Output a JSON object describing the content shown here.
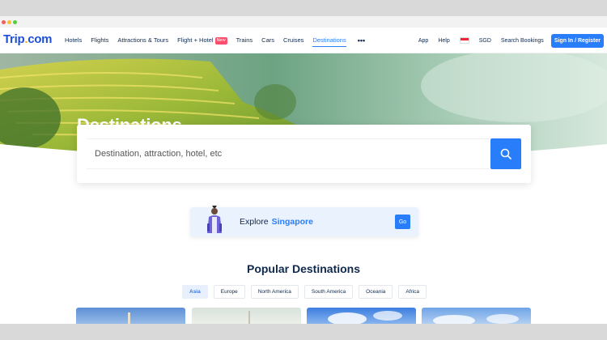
{
  "window": {
    "controls": [
      "close",
      "minimize",
      "maximize"
    ]
  },
  "header": {
    "logo_main": "Trip",
    "logo_dot": ".",
    "logo_suffix": "com",
    "nav": [
      {
        "label": "Hotels"
      },
      {
        "label": "Flights"
      },
      {
        "label": "Attractions & Tours"
      },
      {
        "label": "Flight + Hotel",
        "badge": "New"
      },
      {
        "label": "Trains"
      },
      {
        "label": "Cars"
      },
      {
        "label": "Cruises"
      },
      {
        "label": "Destinations",
        "active": true
      }
    ],
    "more_icon": "more-icon",
    "app": "App",
    "help": "Help",
    "flag_icon": "singapore-flag-icon",
    "currency": "SGD",
    "search_bookings": "Search Bookings",
    "signin": "Sign In / Register"
  },
  "hero": {
    "title": "Destinations"
  },
  "search": {
    "placeholder": "Destination, attraction, hotel, etc",
    "button_icon": "search-icon"
  },
  "explore": {
    "prefix": "Explore",
    "city": "Singapore",
    "button": "Go"
  },
  "popular": {
    "title": "Popular Destinations",
    "tabs": [
      {
        "label": "Asia",
        "active": true
      },
      {
        "label": "Europe"
      },
      {
        "label": "North America"
      },
      {
        "label": "South America"
      },
      {
        "label": "Oceania"
      },
      {
        "label": "Africa"
      }
    ]
  },
  "colors": {
    "accent": "#287dfa",
    "logo": "#1d4fd8",
    "text": "#0f294d",
    "badge_new": "#ff4d6d"
  }
}
